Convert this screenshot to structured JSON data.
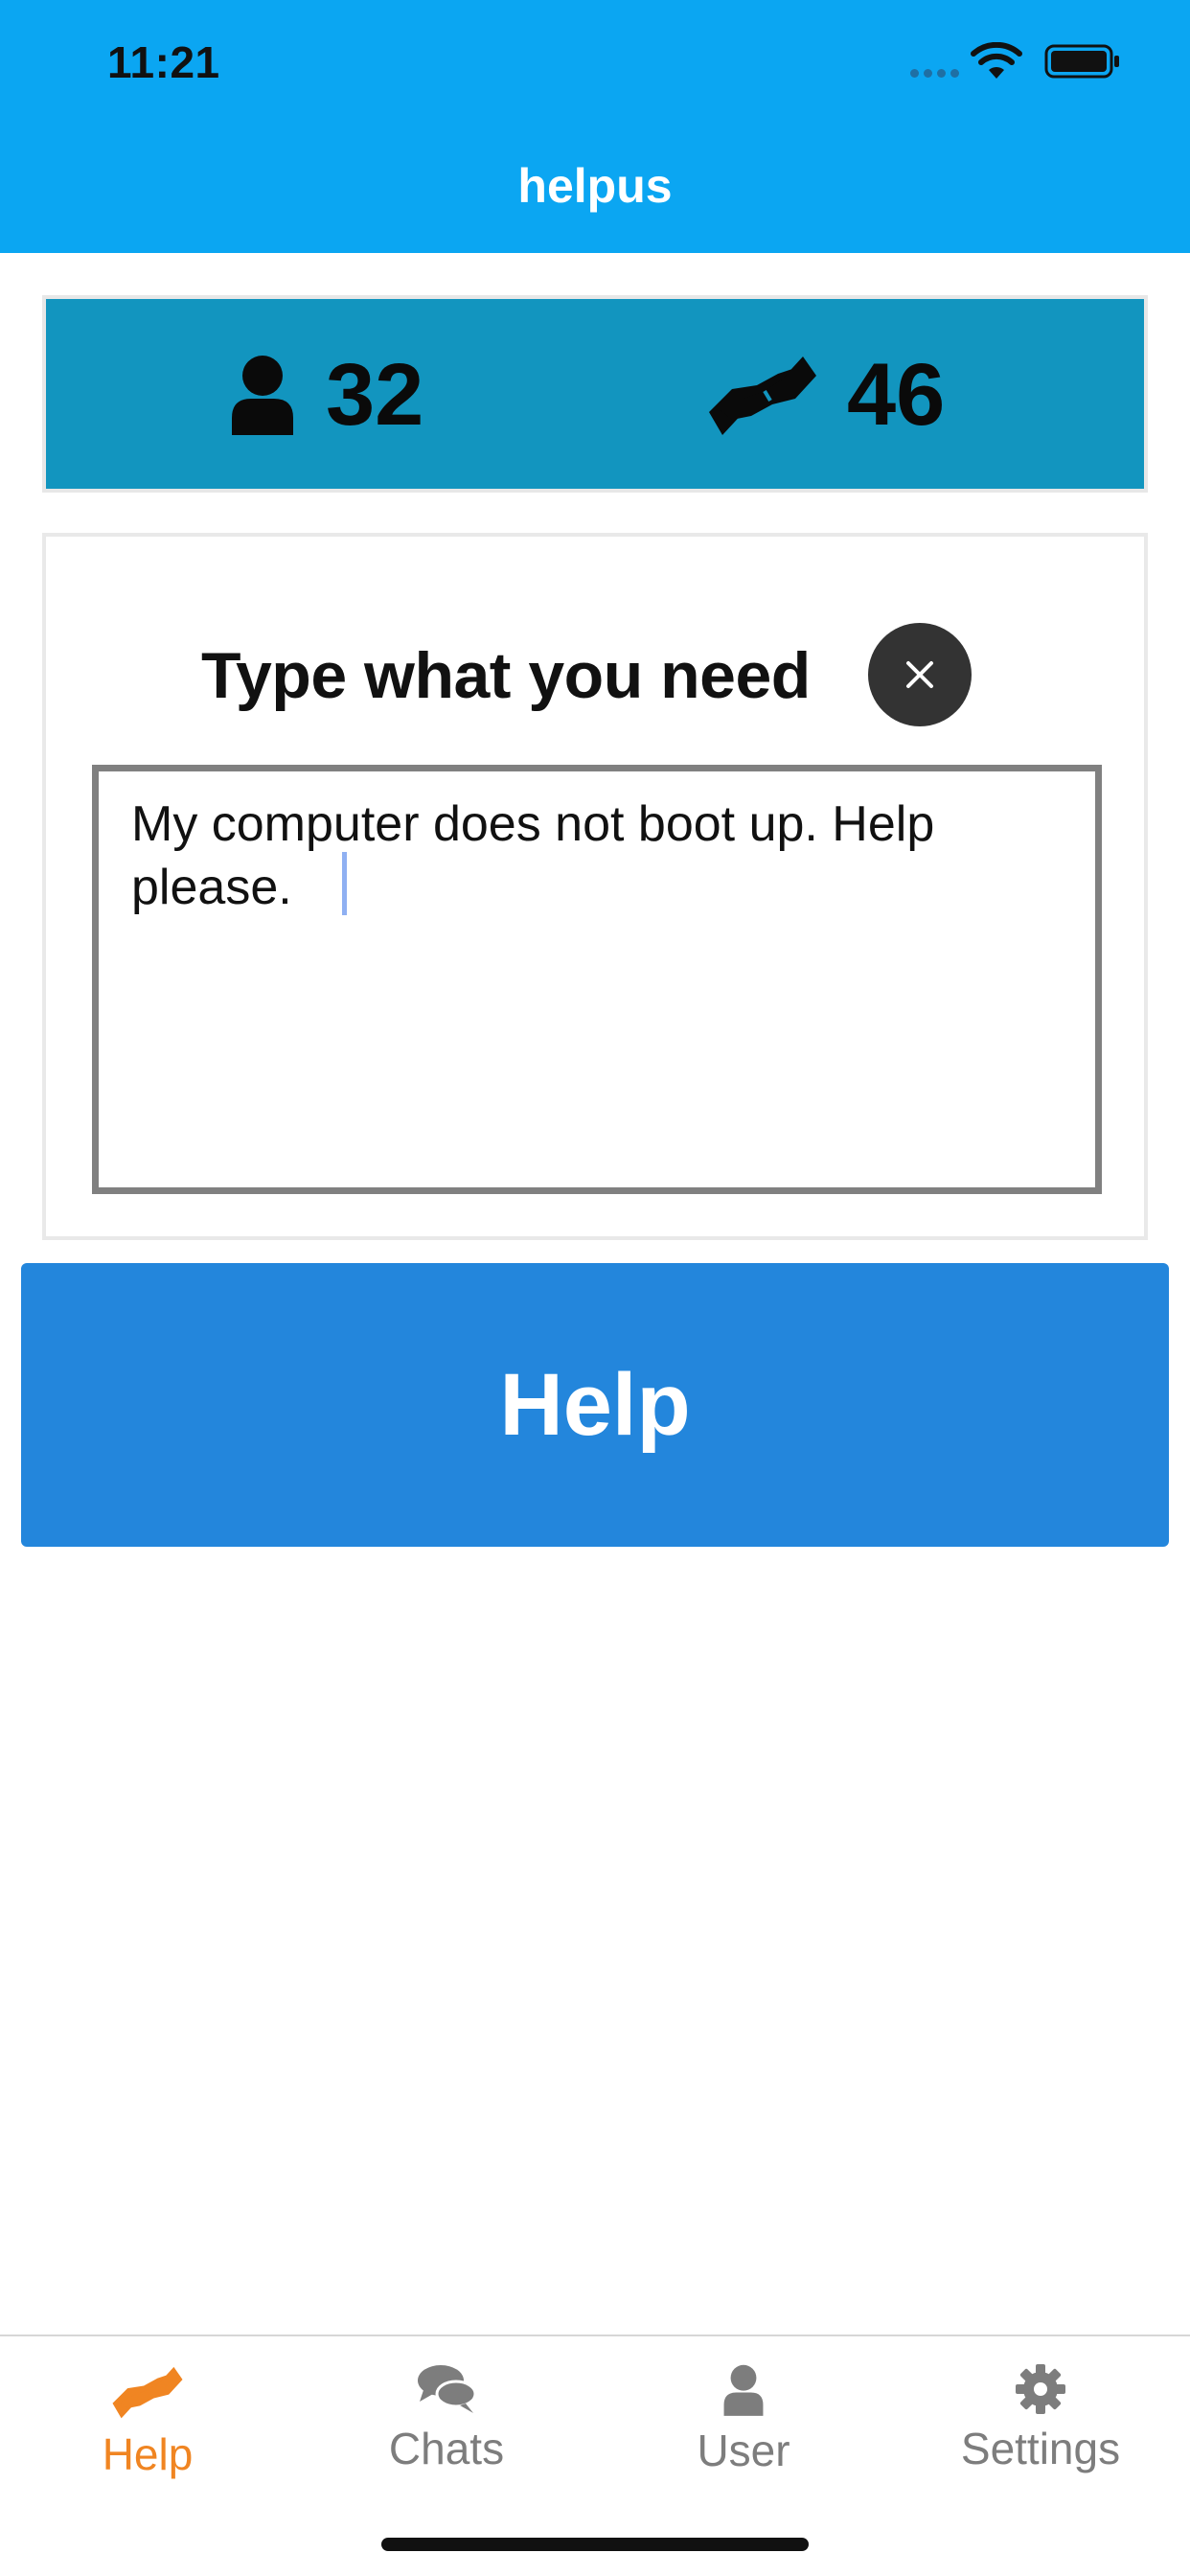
{
  "status_bar": {
    "time": "11:21"
  },
  "app": {
    "title": "helpus"
  },
  "stats": {
    "users_count": "32",
    "helps_count": "46"
  },
  "request": {
    "title": "Type what you need",
    "text": "My computer does not boot up. Help please."
  },
  "help_button": {
    "label": "Help"
  },
  "tabs": [
    {
      "label": "Help",
      "icon": "handshake-icon",
      "active": true
    },
    {
      "label": "Chats",
      "icon": "chat-bubbles-icon",
      "active": false
    },
    {
      "label": "User",
      "icon": "user-icon",
      "active": false
    },
    {
      "label": "Settings",
      "icon": "gear-icon",
      "active": false
    }
  ],
  "colors": {
    "header": "#0ba6f2",
    "stats_card": "#1295bf",
    "help_button": "#2386dc",
    "tab_active": "#f08522",
    "tab_inactive": "#7d7d7d"
  }
}
